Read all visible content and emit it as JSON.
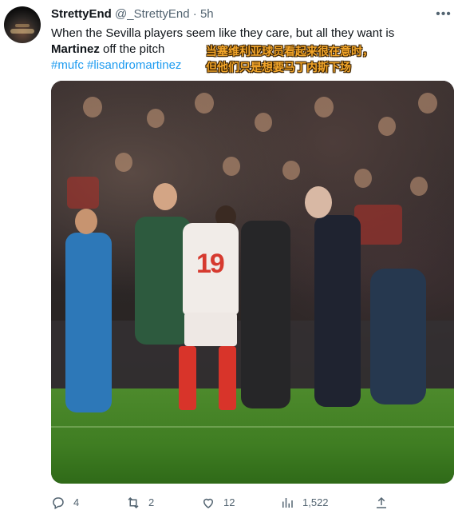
{
  "tweet": {
    "author_name": "StrettyEnd",
    "author_handle": "@_StrettyEnd",
    "separator": "·",
    "time": "5h",
    "text_line1": "When the Sevilla players seem like they care, but all they want is",
    "text_bold": "Martinez",
    "text_line2_rest": " off the pitch",
    "hashtags": [
      "#mufc",
      "#lisandromartinez"
    ],
    "cn_caption_line1": "当塞维利亚球员看起来很在意时，",
    "cn_caption_line2": "但他们只是想要马丁内斯下场"
  },
  "media": {
    "player_number": "19"
  },
  "actions": {
    "reply_count": "4",
    "retweet_count": "2",
    "like_count": "12",
    "views_count": "1,522"
  },
  "icons": [
    "more-icon",
    "reply-icon",
    "retweet-icon",
    "like-icon",
    "views-icon",
    "share-icon"
  ],
  "colors": {
    "link": "#1d9bf0",
    "muted": "#536471",
    "caption": "#f3a62a"
  }
}
